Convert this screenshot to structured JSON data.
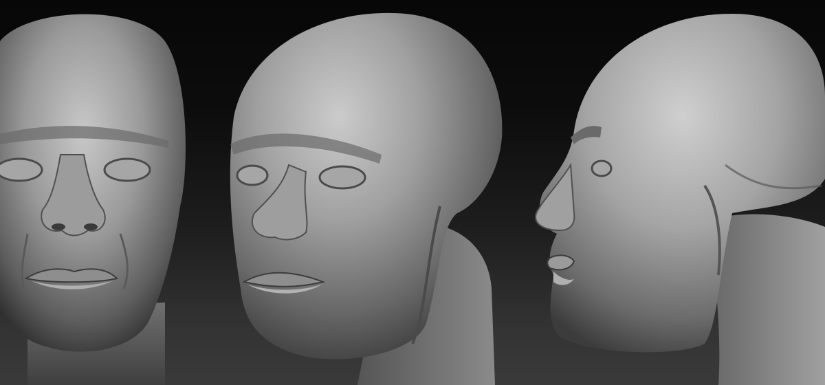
{
  "scene": {
    "background": {
      "top_color": "#070707",
      "bottom_color": "#3a3a3a"
    },
    "material_color": "#8c8c8c",
    "views": [
      {
        "id": "front",
        "label": ""
      },
      {
        "id": "three-quarter",
        "label": ""
      },
      {
        "id": "profile",
        "label": ""
      }
    ]
  }
}
